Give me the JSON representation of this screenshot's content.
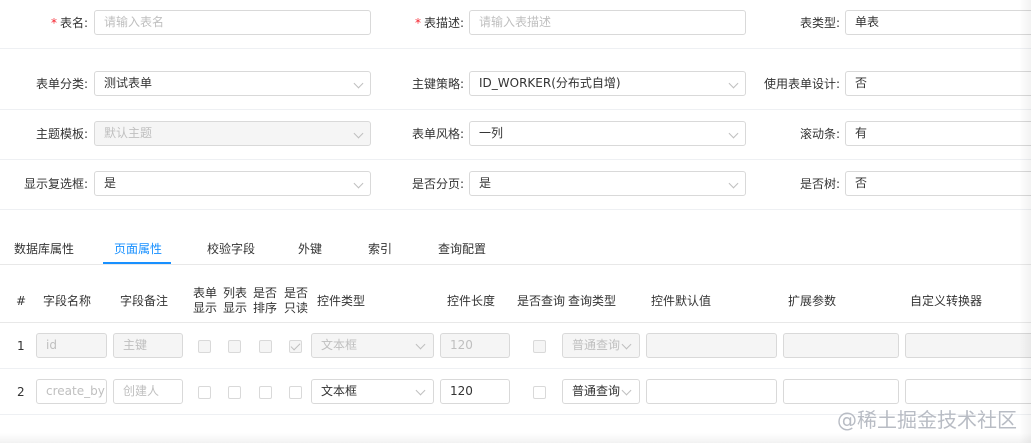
{
  "form": {
    "row1": {
      "table_name": {
        "label": "表名:",
        "required_mark": "*",
        "placeholder": "请输入表名"
      },
      "table_desc": {
        "label": "表描述:",
        "required_mark": "*",
        "placeholder": "请输入表描述"
      },
      "table_type": {
        "label": "表类型:",
        "value": "单表"
      }
    },
    "row2": {
      "form_category": {
        "label": "表单分类:",
        "value": "测试表单"
      },
      "pk_strategy": {
        "label": "主键策略:",
        "value": "ID_WORKER(分布式自增)"
      },
      "use_form_design": {
        "label": "使用表单设计:",
        "value": "否"
      }
    },
    "row3": {
      "theme_template": {
        "label": "主题模板:",
        "value": "默认主题"
      },
      "form_style": {
        "label": "表单风格:",
        "value": "一列"
      },
      "scrollbar": {
        "label": "滚动条:",
        "value": "有"
      }
    },
    "row4": {
      "show_checkbox": {
        "label": "显示复选框:",
        "value": "是"
      },
      "paginate": {
        "label": "是否分页:",
        "value": "是"
      },
      "is_tree": {
        "label": "是否树:",
        "value": "否"
      }
    }
  },
  "tabs": [
    "数据库属性",
    "页面属性",
    "校验字段",
    "外键",
    "索引",
    "查询配置"
  ],
  "active_tab": "页面属性",
  "columns": {
    "index": "#",
    "field_name": "字段名称",
    "field_remark": "字段备注",
    "form_show": [
      "表单",
      "显示"
    ],
    "list_show": [
      "列表",
      "显示"
    ],
    "sortable": [
      "是否",
      "排序"
    ],
    "readonly": [
      "是否",
      "只读"
    ],
    "control_type": "控件类型",
    "control_length": "控件长度",
    "queryable": "是否查询",
    "query_type": "查询类型",
    "default_value": "控件默认值",
    "ext_params": "扩展参数",
    "converter": "自定义转换器"
  },
  "rows": [
    {
      "index": "1",
      "field_name": "id",
      "field_remark": "主键",
      "form_show": false,
      "list_show": false,
      "sortable": false,
      "readonly": true,
      "control_type": "文本框",
      "control_length": "120",
      "queryable": false,
      "query_type": "普通查询",
      "disabled": true
    },
    {
      "index": "2",
      "field_name": "create_by",
      "field_remark": "创建人",
      "form_show": false,
      "list_show": false,
      "sortable": false,
      "readonly": false,
      "control_type": "文本框",
      "control_length": "120",
      "queryable": false,
      "query_type": "普通查询",
      "disabled": false
    }
  ],
  "watermark": "@稀土掘金技术社区",
  "colors": {
    "accent": "#1890ff",
    "required": "#f5222d",
    "border": "#d9d9d9",
    "disabled_bg": "#f5f5f5"
  }
}
